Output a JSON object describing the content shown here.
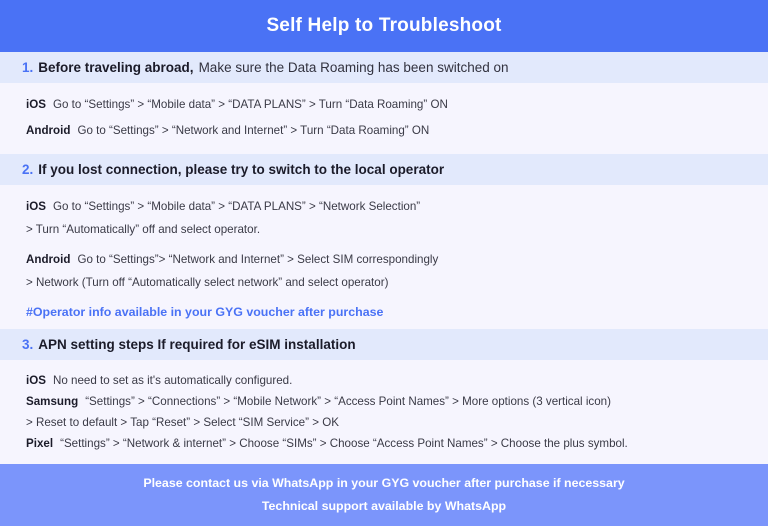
{
  "header": {
    "title": "Self Help to Troubleshoot",
    "bg_color": "#4a72f5",
    "text_color": "#ffffff"
  },
  "colors": {
    "page_bg": "#f6f5fe",
    "band_bg": "#e2e9fc",
    "accent_blue": "#4a72f5",
    "footer_bg": "#7b95fb",
    "body_text": "#3a3a46"
  },
  "sections": [
    {
      "number": "1.",
      "heading_strong": "Before traveling abroad,",
      "heading_rest": "Make sure the Data Roaming has been switched on",
      "lines": [
        {
          "platform": "iOS",
          "text": "Go to “Settings” > “Mobile data” > “DATA PLANS” > Turn “Data Roaming” ON"
        },
        {
          "platform": "Android",
          "text": "Go to “Settings” > “Network and Internet” > Turn “Data Roaming” ON"
        }
      ],
      "note": ""
    },
    {
      "number": "2.",
      "heading_strong": "If you lost connection, please try to switch to the local operator",
      "heading_rest": "",
      "lines": [
        {
          "platform": "iOS",
          "text": "Go to “Settings” > “Mobile data” > “DATA PLANS” > “Network Selection”"
        },
        {
          "platform": "",
          "text": "> Turn “Automatically” off and select operator."
        },
        {
          "platform": "Android",
          "text": "Go to “Settings”>  “Network and Internet” > Select SIM correspondingly"
        },
        {
          "platform": "",
          "text": "> Network (Turn off “Automatically select network” and select operator)"
        }
      ],
      "note": "#Operator info available in your GYG voucher after purchase"
    },
    {
      "number": "3.",
      "heading_strong": "APN setting steps If required for eSIM installation",
      "heading_rest": "",
      "lines": [
        {
          "platform": "iOS",
          "text": "No need to set as it's automatically configured."
        },
        {
          "platform": "Samsung",
          "text": "“Settings” > “Connections” > “Mobile Network” > “Access Point Names” > More options (3 vertical icon)"
        },
        {
          "platform": "",
          "text": "> Reset to default > Tap “Reset” > Select “SIM Service” > OK"
        },
        {
          "platform": "Pixel",
          "text": "“Settings” > “Network & internet” > Choose “SIMs” > Choose “Access Point Names” > Choose the plus symbol."
        }
      ],
      "note": ""
    }
  ],
  "footer": {
    "line1": "Please contact us via WhatsApp  in your GYG voucher after purchase if necessary",
    "line2": "Technical support available by WhatsApp"
  }
}
